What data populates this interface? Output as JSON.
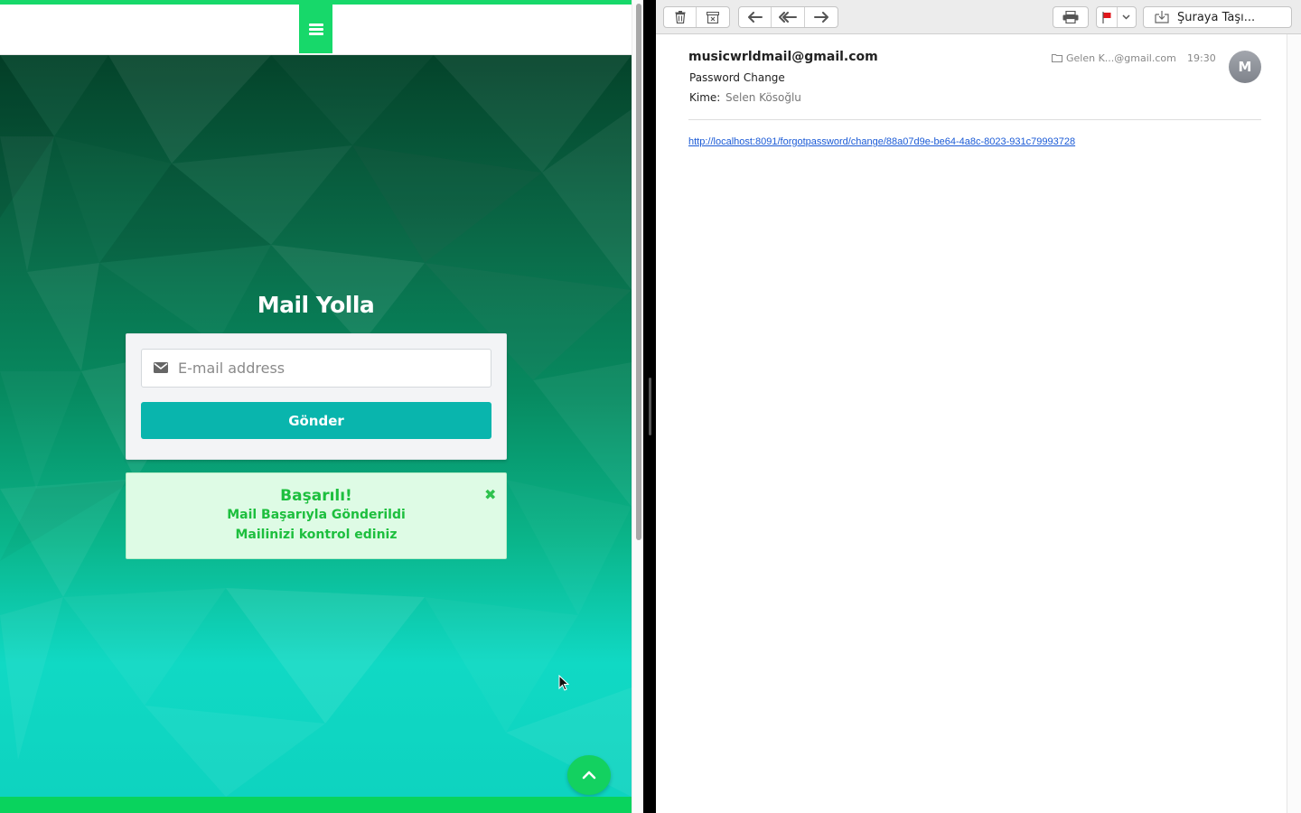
{
  "browser_page": {
    "form": {
      "title": "Mail Yolla",
      "email_placeholder": "E-mail address",
      "submit_label": "Gönder"
    },
    "alert": {
      "title": "Başarılı!",
      "line1": "Mail Başarıyla Gönderildi",
      "line2": "Mailinizi kontrol ediniz",
      "close_glyph": "✖"
    },
    "icons": {
      "menu": "hamburger-icon",
      "email": "envelope-icon",
      "to_top": "chevron-up-icon"
    },
    "colors": {
      "accent": "#17d86a",
      "button": "#09b5ad",
      "alert_bg": "#defbe5",
      "alert_text": "#1dbf3e"
    }
  },
  "mail_client": {
    "toolbar": {
      "move_label": "Şuraya Taşı...",
      "icons": [
        "trash-icon",
        "archive-icon",
        "reply-icon",
        "reply-all-icon",
        "forward-icon",
        "print-icon",
        "flag-icon",
        "chevron-down-icon",
        "move-to-folder-icon"
      ]
    },
    "message": {
      "sender": "musicwrldmail@gmail.com",
      "subject": "Password Change",
      "to_label": "Kime:",
      "to_value": "Selen Kösoğlu",
      "folder": "Gelen K...@gmail.com",
      "time": "19:30",
      "avatar_initial": "M",
      "body_link": "http://localhost:8091/forgotpassword/change/88a07d9e-be64-4a8c-8023-931c79993728"
    },
    "colors": {
      "link": "#1a5ad6",
      "flag": "#e0161b"
    }
  }
}
